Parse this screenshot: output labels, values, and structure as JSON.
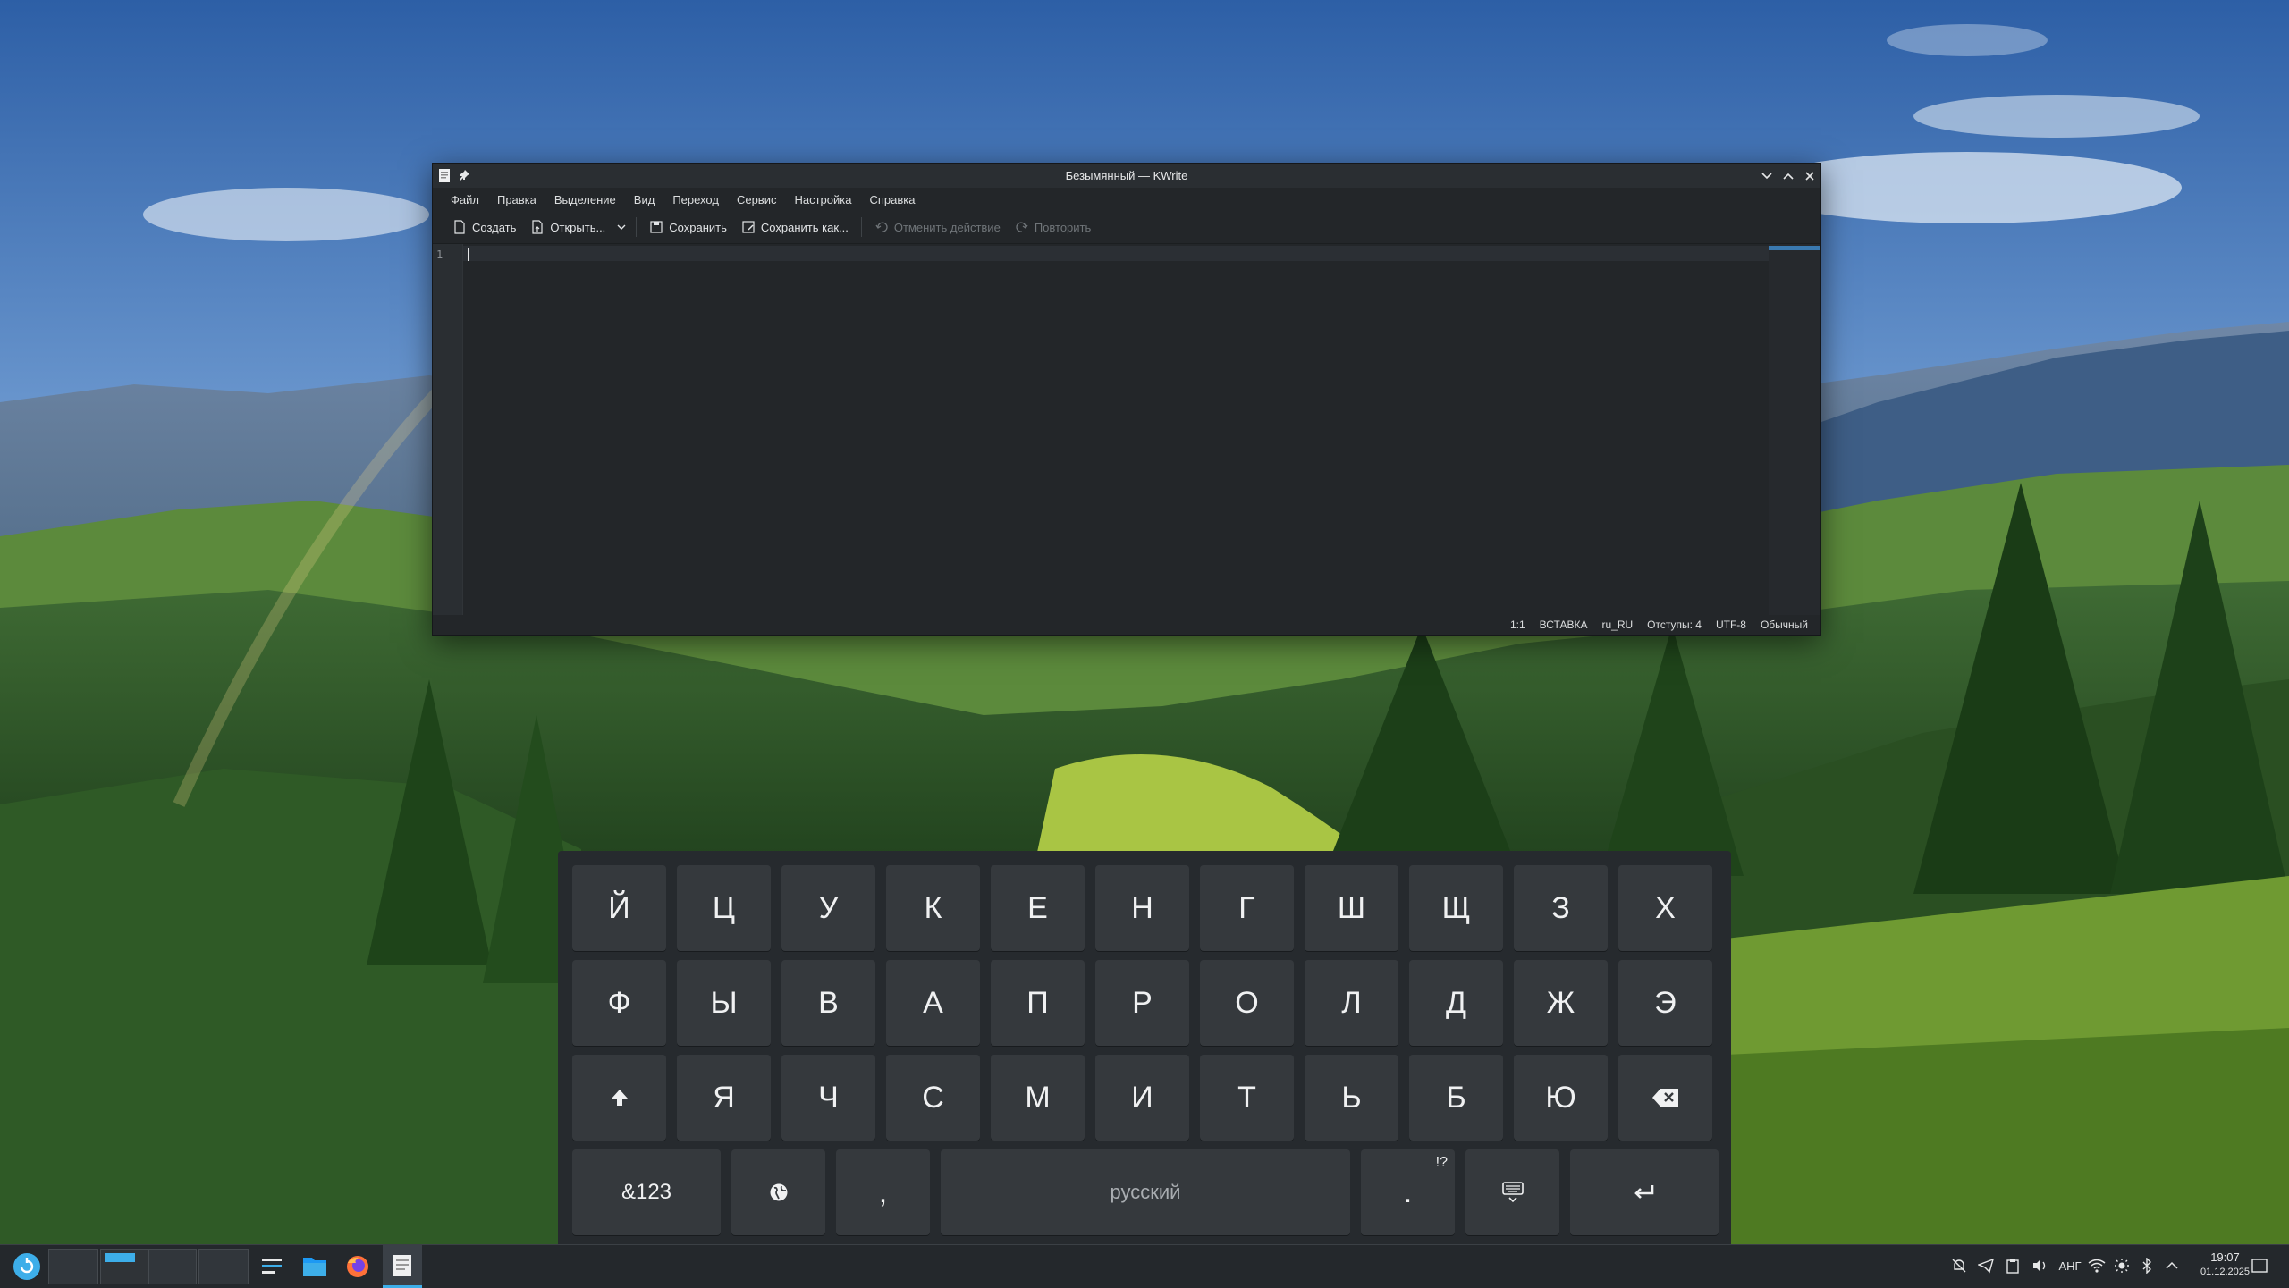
{
  "window": {
    "title": "Безымянный — KWrite"
  },
  "menu": [
    "Файл",
    "Правка",
    "Выделение",
    "Вид",
    "Переход",
    "Сервис",
    "Настройка",
    "Справка"
  ],
  "toolbar": {
    "new_label": "Создать",
    "open_label": "Открыть...",
    "save_label": "Сохранить",
    "save_as_label": "Сохранить как...",
    "undo_label": "Отменить действие",
    "redo_label": "Повторить"
  },
  "editor": {
    "line_number": "1"
  },
  "status": {
    "position": "1:1",
    "mode": "ВСТАВКА",
    "dictionary": "ru_RU",
    "indent": "Отступы: 4",
    "encoding": "UTF-8",
    "syntax": "Обычный"
  },
  "keyboard": {
    "row1": [
      "Й",
      "Ц",
      "У",
      "К",
      "Е",
      "Н",
      "Г",
      "Ш",
      "Щ",
      "З",
      "Х"
    ],
    "row2": [
      "Ф",
      "Ы",
      "В",
      "А",
      "П",
      "Р",
      "О",
      "Л",
      "Д",
      "Ж",
      "Э"
    ],
    "row3": [
      "Я",
      "Ч",
      "С",
      "М",
      "И",
      "Т",
      "Ь",
      "Б",
      "Ю"
    ],
    "symbols_label": "&123",
    "comma": ",",
    "space_label": "русский",
    "period": ".",
    "period_alt": "!?"
  },
  "taskbar": {
    "language": "АНГ",
    "time": "19:07",
    "date": "01.12.2025"
  },
  "colors": {
    "accent": "#3daee9",
    "window_bg": "#232629",
    "key_bg": "#35393d",
    "keyboard_bg": "#262a2e",
    "taskbar_bg": "#24282c"
  },
  "icons": {
    "app": "document-icon",
    "pin": "pin-icon",
    "minimize": "chevron-down-icon",
    "maximize": "chevron-up-icon",
    "close": "close-icon",
    "shift": "shift-up-arrow-icon",
    "backspace": "backspace-icon",
    "globe": "globe-icon",
    "hide_keyboard": "keyboard-hide-icon",
    "enter": "enter-icon"
  }
}
